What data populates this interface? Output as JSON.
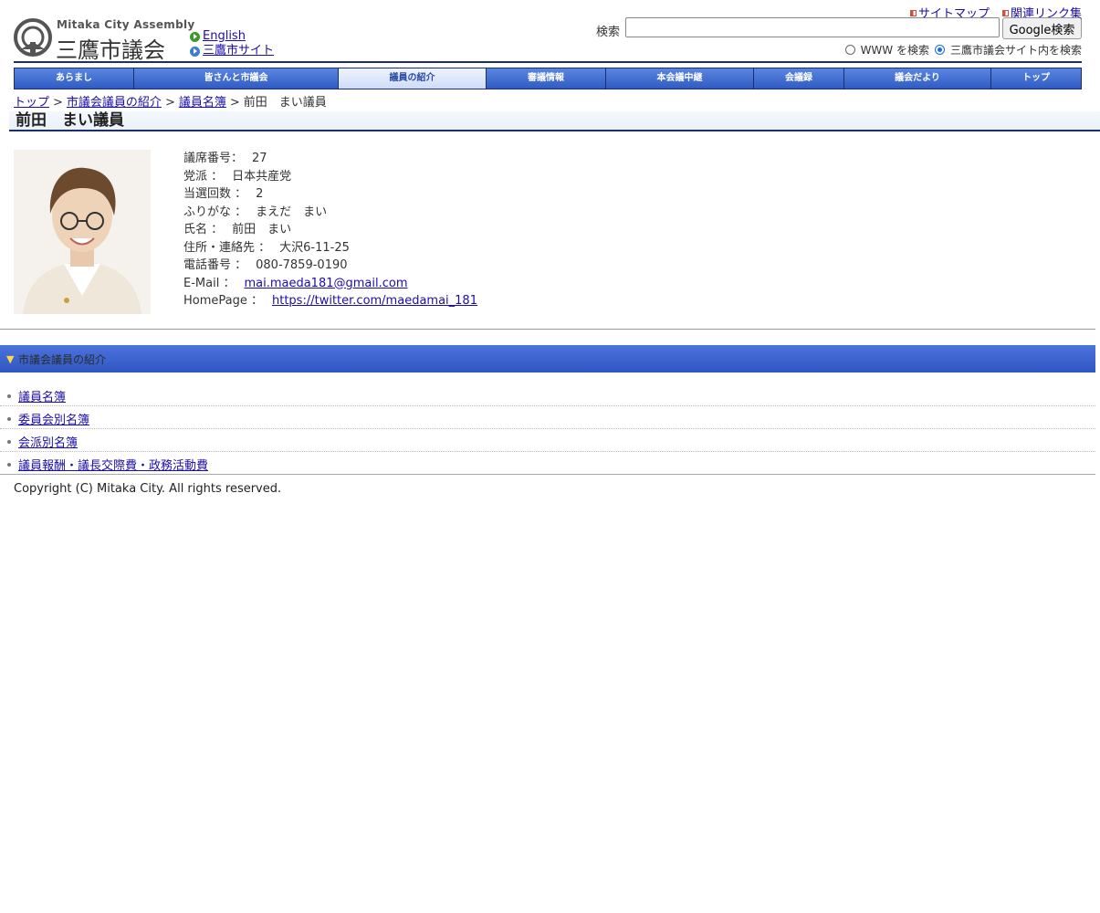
{
  "header": {
    "logo_sub": "Mitaka City Assembly",
    "logo_main": "三鷹市議会",
    "lang_links": [
      "English",
      "三鷹市サイト"
    ],
    "top_links": [
      "サイトマップ",
      "関連リンク集"
    ],
    "search_label": "検索",
    "search_button": "Google検索",
    "search_options": [
      "WWW を検索",
      "三鷹市議会サイト内を検索"
    ],
    "search_selected": "三鷹市議会サイト内を検索"
  },
  "nav": {
    "items": [
      "あらまし",
      "皆さんと市議会",
      "議員の紹介",
      "審議情報",
      "本会議中継",
      "会議録",
      "議会だより",
      "トップ"
    ],
    "active": "議員の紹介"
  },
  "breadcrumb": {
    "items": [
      "トップ",
      "市議会議員の紹介",
      "議員名簿"
    ],
    "current": "前田　まい議員",
    "sep": ">"
  },
  "page_title": "前田　まい議員",
  "profile": {
    "rows": [
      {
        "label": "議席番号：",
        "value": "27"
      },
      {
        "label": "党派 ：",
        "value": "日本共産党"
      },
      {
        "label": "当選回数 ：",
        "value": "2"
      },
      {
        "label": "ふりがな ：",
        "value": "まえだ　まい"
      },
      {
        "label": "氏名 ：",
        "value": "前田　まい"
      },
      {
        "label": "住所・連絡先 ：",
        "value": "大沢6-11-25"
      },
      {
        "label": "電話番号 ：",
        "value": "080-7859-0190"
      },
      {
        "label": "E-Mail ：",
        "value": "mai.maeda181@gmail.com"
      },
      {
        "label": "HomePage ：",
        "value": "https://twitter.com/maedamai_181"
      }
    ]
  },
  "section": {
    "title": "市議会議員の紹介",
    "links": [
      "議員名簿",
      "委員会別名簿",
      "会派別名簿",
      "議員報酬・議長交際費・政務活動費"
    ]
  },
  "footer": "Copyright (C) Mitaka City. All rights reserved."
}
